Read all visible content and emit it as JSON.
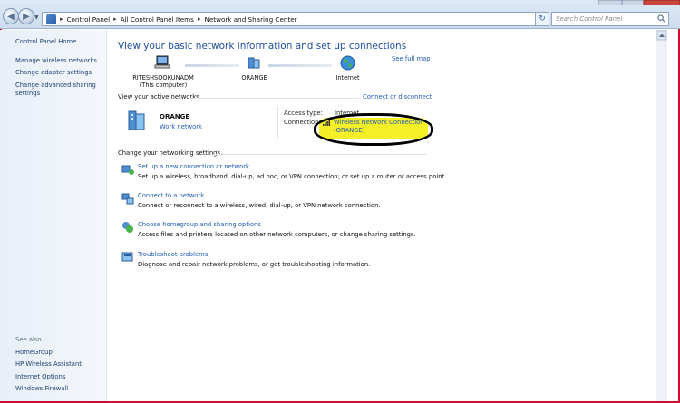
{
  "address_bar": {
    "crumbs": [
      "Control Panel",
      "All Control Panel Items",
      "Network and Sharing Center"
    ]
  },
  "search": {
    "placeholder": "Search Control Panel"
  },
  "sidebar": {
    "items": [
      {
        "label": "Control Panel Home"
      },
      {
        "label": "Manage wireless networks"
      },
      {
        "label": "Change adapter settings"
      },
      {
        "label": "Change advanced sharing settings"
      }
    ],
    "see_also_title": "See also",
    "see_also": [
      {
        "label": "HomeGroup"
      },
      {
        "label": "HP Wireless Assistant"
      },
      {
        "label": "Internet Options"
      },
      {
        "label": "Windows Firewall"
      }
    ]
  },
  "main": {
    "title": "View your basic network information and set up connections",
    "see_full_map": "See full map",
    "map": {
      "computer_name": "RITESHSOOKUNADM",
      "computer_sub": "(This computer)",
      "network_name": "ORANGE",
      "internet": "Internet"
    },
    "active_networks_label": "View your active networks",
    "connect_disconnect": "Connect or disconnect",
    "network": {
      "name": "ORANGE",
      "type": "Work network",
      "access_type_label": "Access type:",
      "access_type_value": "Internet",
      "connections_label": "Connections:",
      "connection_line1": "Wireless Network Connection",
      "connection_line2": "(ORANGE)"
    },
    "change_settings_label": "Change your networking settings",
    "tasks": [
      {
        "title": "Set up a new connection or network",
        "desc": "Set up a wireless, broadband, dial-up, ad hoc, or VPN connection; or set up a router or access point."
      },
      {
        "title": "Connect to a network",
        "desc": "Connect or reconnect to a wireless, wired, dial-up, or VPN network connection."
      },
      {
        "title": "Choose homegroup and sharing options",
        "desc": "Access files and printers located on other network computers, or change sharing settings."
      },
      {
        "title": "Troubleshoot problems",
        "desc": "Diagnose and repair network problems, or get troubleshooting information."
      }
    ]
  },
  "colors": {
    "link": "#1f5bb5",
    "title": "#1f4e9c",
    "highlight": "#f4ee1a",
    "frame": "#c8102e"
  }
}
